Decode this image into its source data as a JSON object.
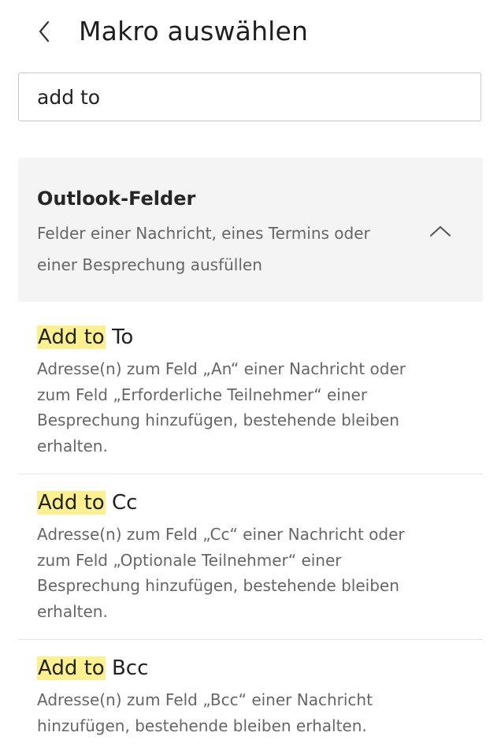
{
  "header": {
    "title": "Makro auswählen",
    "back_icon": "chevron-left-icon"
  },
  "search": {
    "value": "add to",
    "placeholder": ""
  },
  "group": {
    "title": "Outlook-Felder",
    "description": "Felder einer Nachricht, eines Termins oder einer Besprechung ausfüllen",
    "expanded": true,
    "toggle_icon": "chevron-up-icon"
  },
  "macros": [
    {
      "highlight": "Add to",
      "rest": " To",
      "description": "Adresse(n) zum Feld „An“ einer Nachricht oder zum Feld „Erforderliche Teilnehmer“ einer Besprechung hinzufügen, bestehende bleiben erhalten."
    },
    {
      "highlight": "Add to",
      "rest": " Cc",
      "description": "Adresse(n) zum Feld „Cc“ einer Nachricht oder zum Feld „Optionale Teilnehmer“ einer Besprechung hinzufügen, bestehende bleiben erhalten."
    },
    {
      "highlight": "Add to",
      "rest": " Bcc",
      "description": "Adresse(n) zum Feld „Bcc“ einer Nachricht hinzufügen, bestehende bleiben erhalten."
    }
  ],
  "colors": {
    "highlight": "#fdf08e",
    "group_background": "#f4f4f4",
    "secondary_text": "#666666"
  }
}
